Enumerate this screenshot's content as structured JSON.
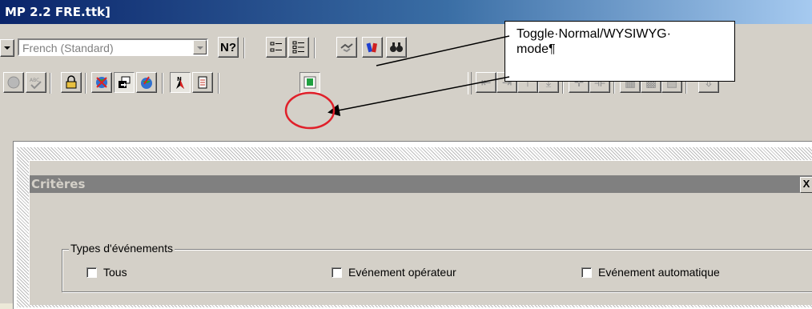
{
  "window": {
    "title": "MP 2.2 FRE.ttk]"
  },
  "toolbar1": {
    "language_combo": "French (Standard)",
    "help_button": "N?"
  },
  "callout": {
    "line1": "Toggle·Normal/WYSIWYG·",
    "line2": "mode¶"
  },
  "criteria": {
    "title": "Critères",
    "close": "X",
    "group_label": "Types d'événements",
    "checkboxes": [
      {
        "label": "Tous",
        "checked": false
      },
      {
        "label": "Evénement opérateur",
        "checked": false
      },
      {
        "label": "Evénement automatique",
        "checked": false
      }
    ]
  },
  "colors": {
    "titlebar": "#0a246a",
    "highlight_circle": "#e0202a",
    "face": "#d4d0c8"
  }
}
